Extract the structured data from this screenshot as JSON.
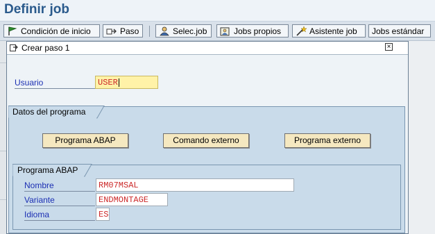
{
  "window": {
    "title": "Definir job"
  },
  "toolbar": {
    "buttons": [
      {
        "label": "Condición de inicio",
        "icon": "flag-icon"
      },
      {
        "label": "Paso",
        "icon": "step-icon"
      },
      {
        "label": "Selec.job",
        "icon": "person-icon"
      },
      {
        "label": "Jobs propios",
        "icon": "own-jobs-icon"
      },
      {
        "label": "Asistente job",
        "icon": "wizard-icon"
      },
      {
        "label": "Jobs estándar",
        "icon": ""
      }
    ]
  },
  "popup": {
    "title": "Crear paso  1",
    "close_icon": "close-icon",
    "user": {
      "label": "Usuario",
      "value": "USER"
    },
    "program_data": {
      "title": "Datos del programa",
      "buttons": {
        "abap": "Programa ABAP",
        "external_command": "Comando externo",
        "external_program": "Programa externo"
      },
      "abap_group": {
        "title": "Programa ABAP",
        "name": {
          "label": "Nombre",
          "value": "RM07MSAL"
        },
        "variant": {
          "label": "Variante",
          "value": "ENDMONTAGE"
        },
        "language": {
          "label": "Idioma",
          "value": "ES"
        }
      }
    }
  },
  "colors": {
    "title": "#2a5a8c",
    "label": "#1b2fb3",
    "field_value": "#cc2a2a",
    "group_bg": "#c9dbea",
    "button_bg": "#f5e8c0"
  }
}
